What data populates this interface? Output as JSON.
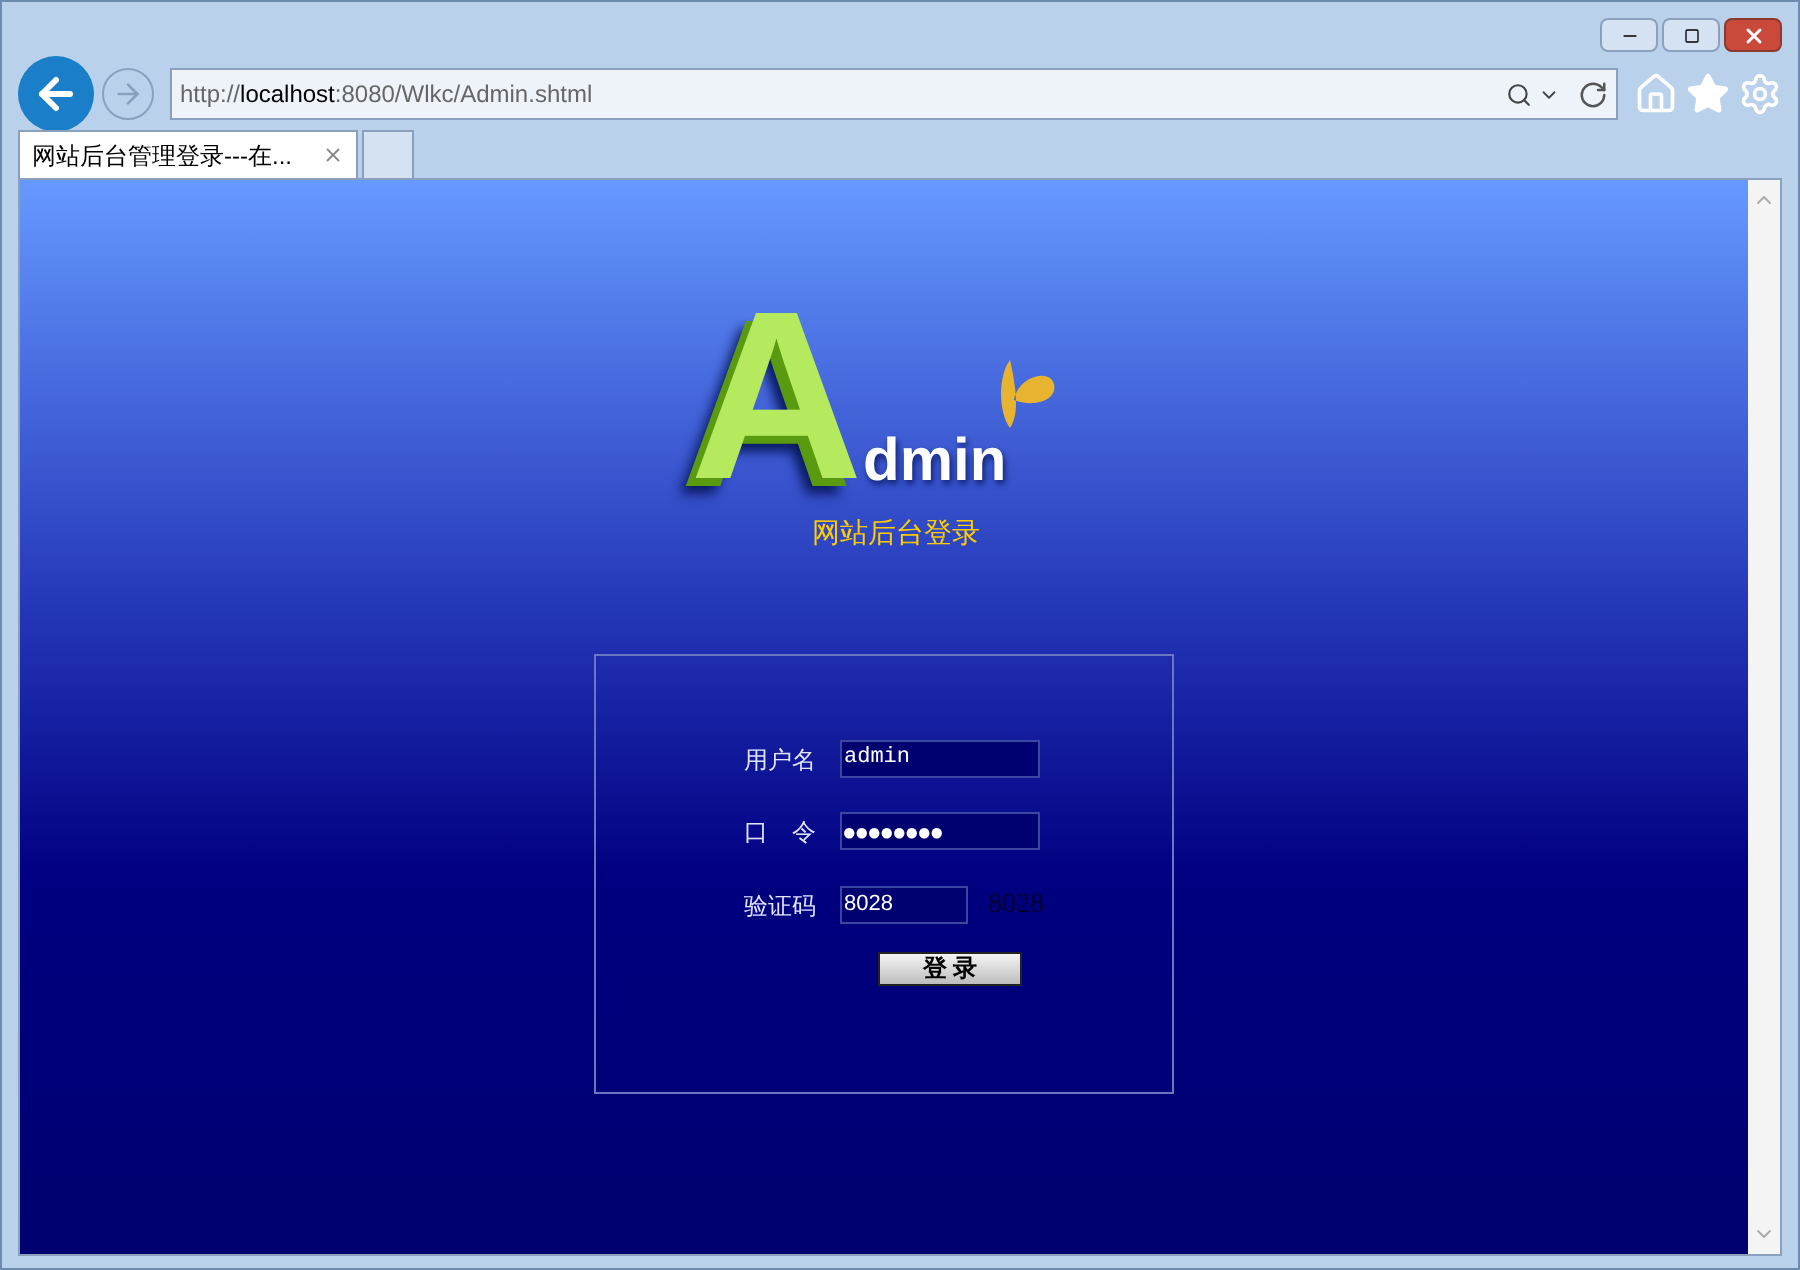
{
  "browser": {
    "url_prefix": "http://",
    "url_host": "localhost",
    "url_rest": ":8080/Wlkc/Admin.shtml",
    "tabs": [
      {
        "title": "网站后台管理登录---在...",
        "selected": true
      }
    ]
  },
  "logo": {
    "big_letter": "A",
    "rest": "dmin"
  },
  "subtitle": "网站后台登录",
  "form": {
    "fields": [
      {
        "kind": "text",
        "label": "用户名",
        "value": "admin"
      },
      {
        "kind": "password",
        "label": "口　令",
        "value": "●●●●●●●●"
      },
      {
        "kind": "captcha",
        "label": "验证码",
        "value": "8028",
        "code": "8028"
      }
    ],
    "submit": "登 录"
  }
}
